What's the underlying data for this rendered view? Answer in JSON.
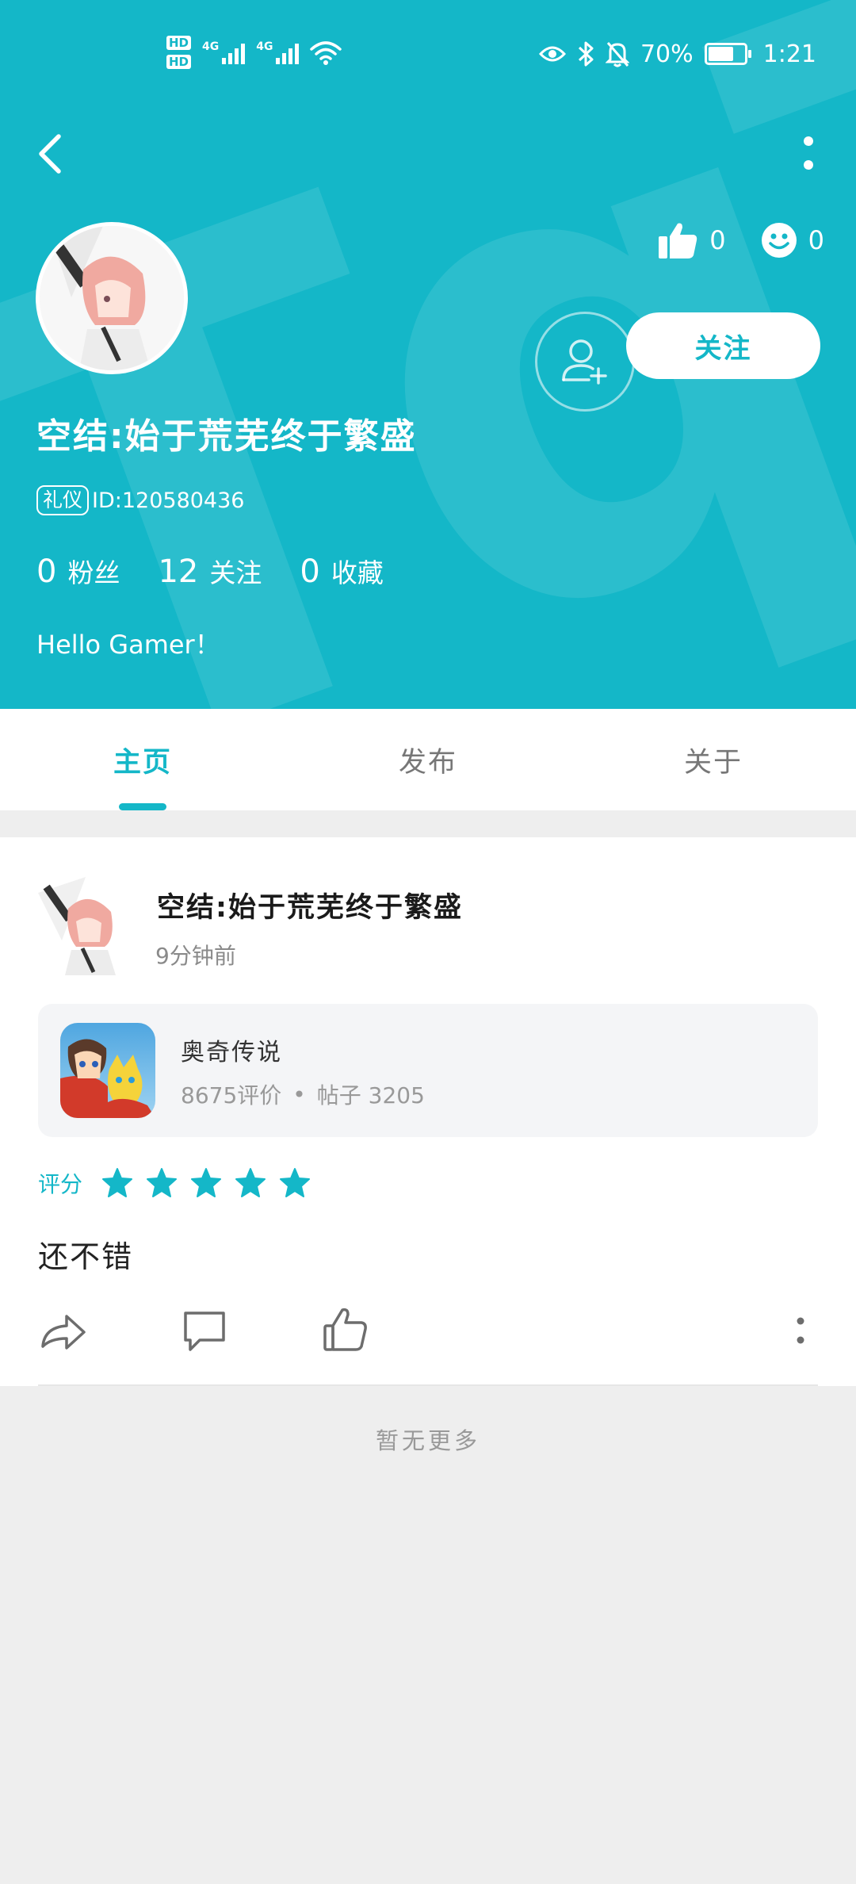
{
  "status_bar": {
    "hd_1": "HD",
    "hd_2": "HD",
    "signal_1": "4G",
    "signal_2": "4G",
    "battery_text": "70%",
    "battery_level": 0.7,
    "time": "1:21"
  },
  "profile": {
    "username": "空结:始于荒芜终于繁盛",
    "tag": "礼仪",
    "id_text": "ID:120580436",
    "likes": "0",
    "smiles": "0",
    "follow_label": "关注",
    "fans_count": "0",
    "fans_label": "粉丝",
    "following_count": "12",
    "following_label": "关注",
    "favorites_count": "0",
    "favorites_label": "收藏",
    "bio": "Hello Gamer！"
  },
  "tabs": [
    {
      "label": "主页",
      "active": true
    },
    {
      "label": "发布",
      "active": false
    },
    {
      "label": "关于",
      "active": false
    }
  ],
  "post": {
    "author": "空结:始于荒芜终于繁盛",
    "time": "9分钟前",
    "game": {
      "name": "奥奇传说",
      "reviews": "8675评价",
      "separator": "•",
      "posts": "帖子 3205"
    },
    "rating_label": "评分",
    "stars": 5,
    "review_text": "还不错"
  },
  "footer": {
    "no_more": "暂无更多"
  },
  "colors": {
    "accent": "#14b7c8",
    "background": "#eeeeee"
  }
}
